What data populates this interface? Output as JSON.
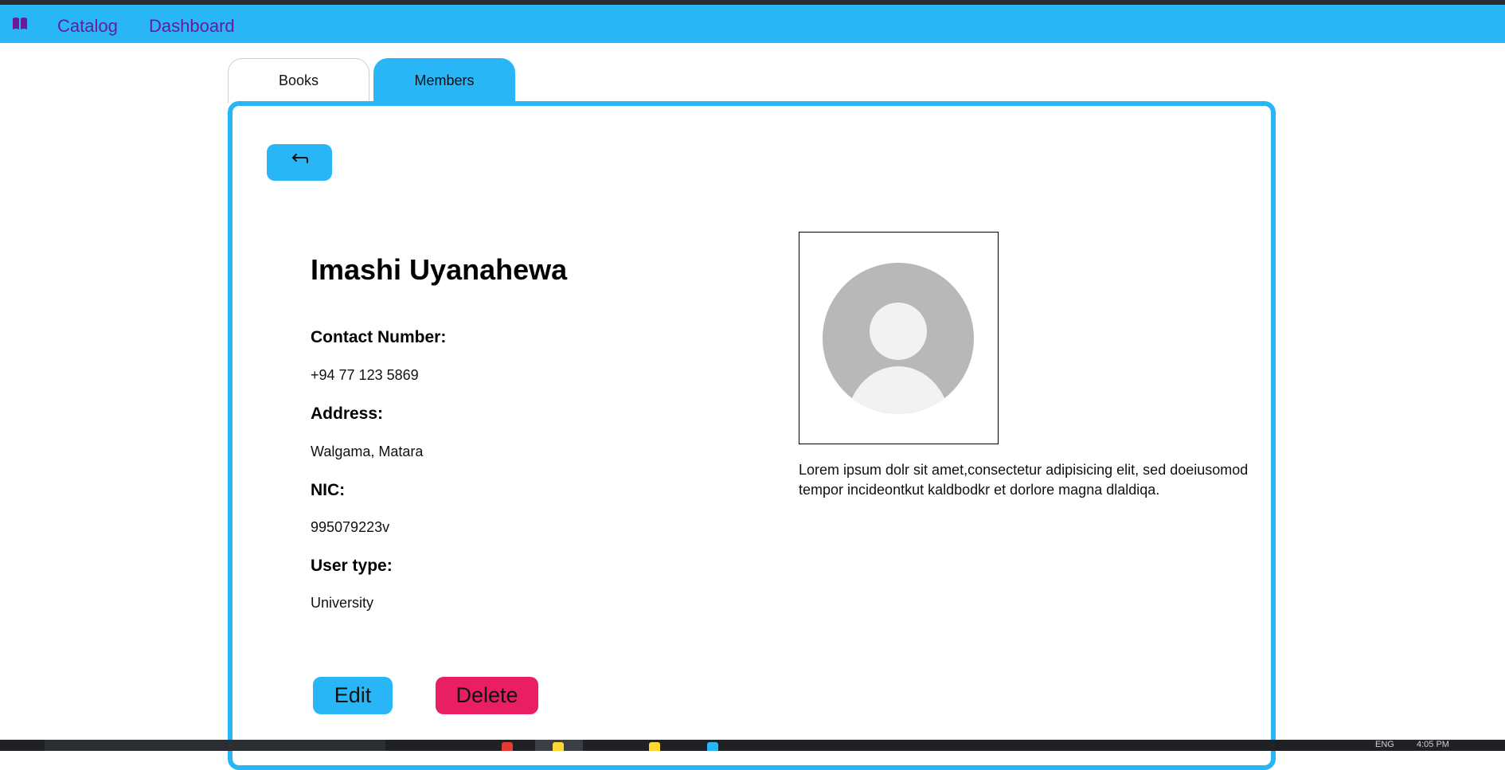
{
  "navbar": {
    "logo_icon": "book-icon",
    "links": [
      "Catalog",
      "Dashboard"
    ],
    "background": "#29b6f6",
    "link_color": "#6a1b9a"
  },
  "tabs": [
    {
      "label": "Books",
      "active": false
    },
    {
      "label": "Members",
      "active": true
    }
  ],
  "back_button": {
    "icon": "return-arrow-icon"
  },
  "member": {
    "name": "Imashi Uyanahewa",
    "fields": [
      {
        "label": "Contact Number:",
        "value": "+94 77 123 5869"
      },
      {
        "label": "Address:",
        "value": "Walgama, Matara"
      },
      {
        "label": "NIC:",
        "value": "995079223v"
      },
      {
        "label": "User type:",
        "value": "University"
      }
    ],
    "avatar_icon": "user-avatar-icon",
    "bio": "Lorem ipsum dolr sit amet,consectetur adipisicing elit, sed doeiusomod tempor incideontkut kaldbodkr et dorlore magna dlaldiqa."
  },
  "actions": {
    "edit_label": "Edit",
    "delete_label": "Delete",
    "edit_color": "#29b6f6",
    "delete_color": "#e91e63"
  },
  "taskbar": {
    "tray_lang": "ENG",
    "tray_time": "4:05 PM"
  }
}
